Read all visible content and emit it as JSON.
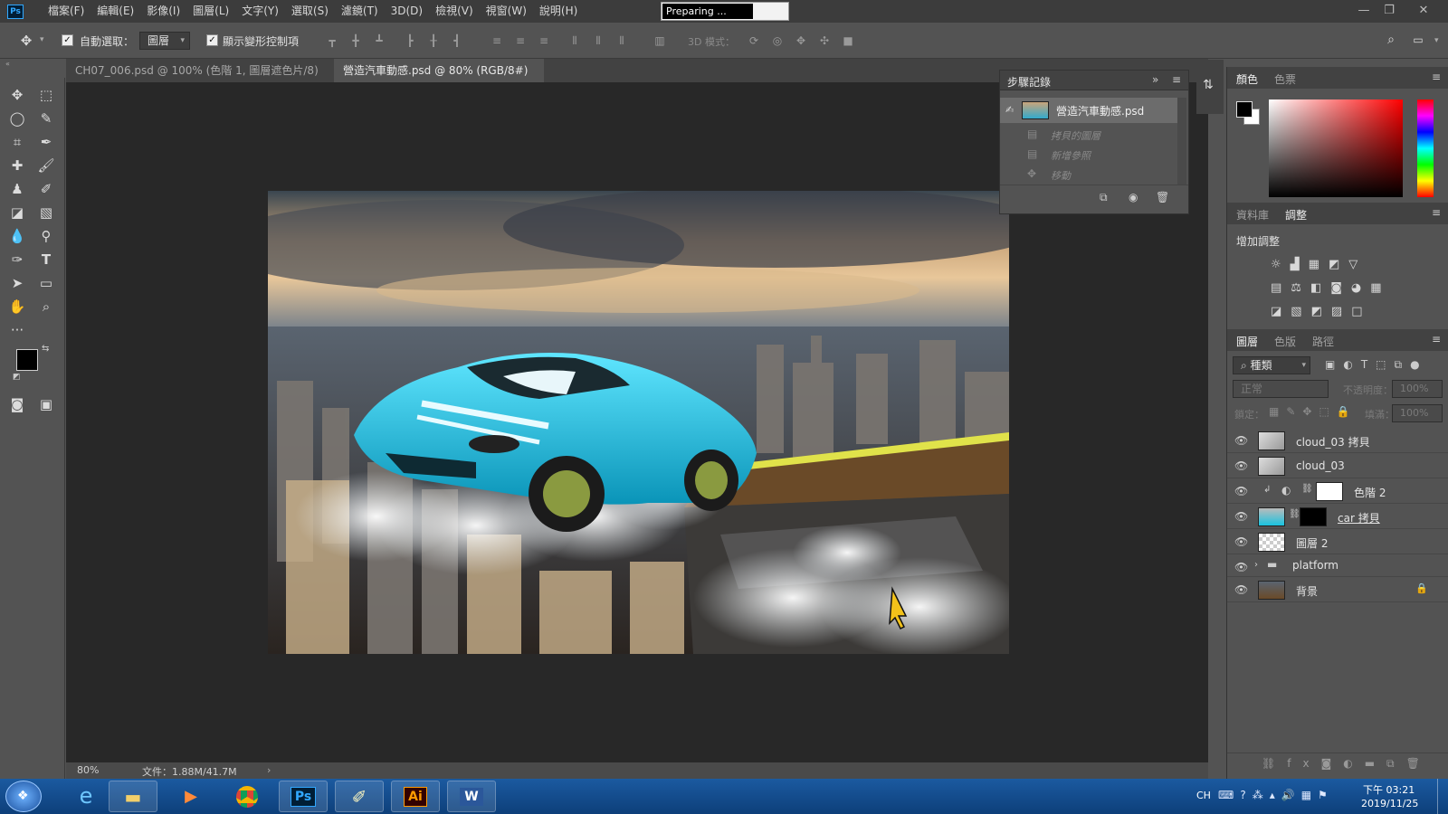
{
  "menubar": {
    "logo": "Ps",
    "items": [
      "檔案(F)",
      "編輯(E)",
      "影像(I)",
      "圖層(L)",
      "文字(Y)",
      "選取(S)",
      "濾鏡(T)",
      "3D(D)",
      "檢視(V)",
      "視窗(W)",
      "說明(H)"
    ],
    "progress_text": "Preparing ..."
  },
  "options": {
    "auto_select_label": "自動選取：",
    "auto_select_value": "圖層",
    "show_transform_label": "顯示變形控制項",
    "mode_3d_label": "3D 模式："
  },
  "tabs": [
    {
      "label": "CH07_006.psd @ 100% (色階 1, 圖層遮色片/8) *"
    },
    {
      "label": "營造汽車動感.psd @ 80% (RGB/8#) *"
    }
  ],
  "status": {
    "zoom": "80%",
    "doc_size": "文件：1.88M/41.7M"
  },
  "history": {
    "title": "步驟記錄",
    "snapshot": "營造汽車動感.psd",
    "steps": [
      "拷貝的圖層",
      "新增參照",
      "移動"
    ]
  },
  "color_panel": {
    "tabs": [
      "顏色",
      "色票"
    ]
  },
  "adjust_panel": {
    "tabs": [
      "資料庫",
      "調整"
    ],
    "title": "增加調整"
  },
  "layers_panel": {
    "tabs": [
      "圖層",
      "色版",
      "路徑"
    ],
    "filter_kind": "種類",
    "blend_mode": "正常",
    "opacity_label": "不透明度：",
    "opacity_value": "100%",
    "lock_label": "鎖定：",
    "fill_label": "填滿：",
    "fill_value": "100%",
    "layers": [
      {
        "name": "cloud_03 拷貝"
      },
      {
        "name": "cloud_03"
      },
      {
        "name": "色階 2"
      },
      {
        "name": "car 拷貝"
      },
      {
        "name": "圖層 2"
      },
      {
        "name": "platform"
      },
      {
        "name": "背景"
      }
    ]
  },
  "taskbar": {
    "ime": "CH",
    "time": "下午 03:21",
    "date": "2019/11/25",
    "apps": [
      "Ps",
      "Ai",
      "W"
    ]
  },
  "colors": {
    "accent_blue": "#31a8ff",
    "car_cyan": "#19c3e0",
    "ai_orange": "#ff9a00"
  }
}
